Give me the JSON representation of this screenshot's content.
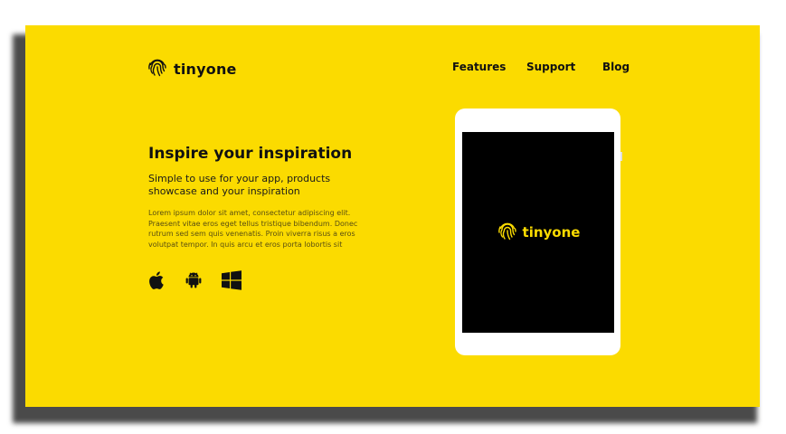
{
  "brand": {
    "name": "tinyone",
    "icon": "fingerprint-icon",
    "accent_color": "#FBDB00"
  },
  "nav": {
    "items": [
      {
        "label": "Features"
      },
      {
        "label": "Support"
      },
      {
        "label": "Blog"
      }
    ]
  },
  "hero": {
    "title": "Inspire your inspiration",
    "subtitle": "Simple to use for your app, products showcase and your inspiration",
    "body": "Lorem ipsum dolor sit amet, consectetur adipiscing elit. Praesent vitae eros eget tellus tristique bibendum. Donec rutrum sed sem quis venenatis. Proin viverra risus a eros volutpat tempor. In quis arcu et eros porta lobortis sit"
  },
  "platforms": [
    {
      "icon": "apple-icon"
    },
    {
      "icon": "android-icon"
    },
    {
      "icon": "windows-icon"
    }
  ],
  "device": {
    "screen_brand": "tinyone",
    "screen_icon": "fingerprint-icon"
  }
}
